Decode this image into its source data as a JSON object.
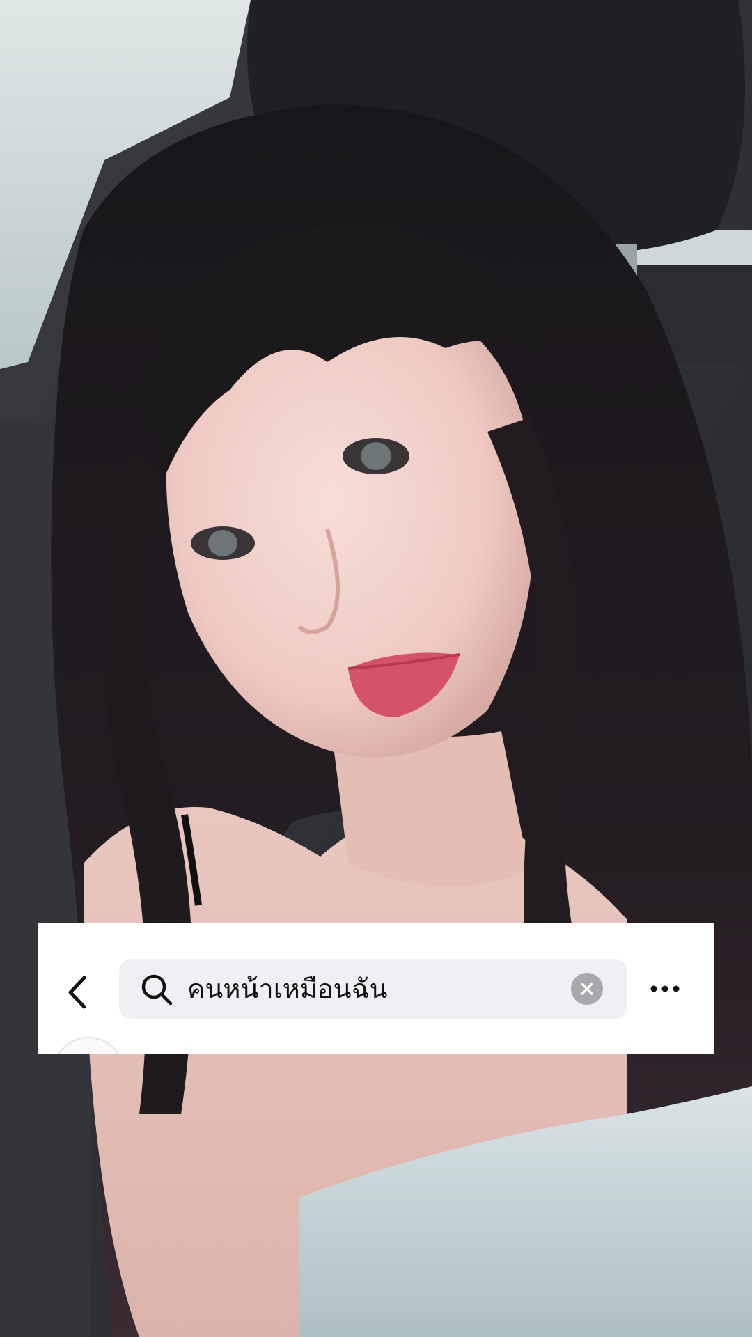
{
  "search": {
    "query": "คนหน้าเหมือนฉัน"
  },
  "icons": {
    "back": "chevron-left-icon",
    "search": "magnifier-icon",
    "clear": "x-circle-icon",
    "more": "ellipsis-icon"
  },
  "colors": {
    "card_background": "#ffffff",
    "search_field_background": "#eff0f3",
    "clear_button": "#a9a9ad",
    "text": "#111111"
  }
}
